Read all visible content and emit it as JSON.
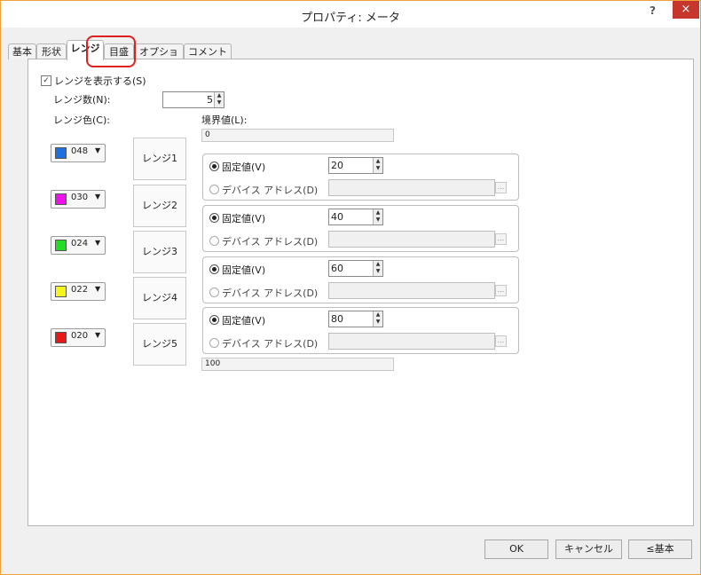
{
  "window": {
    "title": "プロパティ: メータ",
    "help_label": "?",
    "close_label": "×"
  },
  "tabs": [
    {
      "label": "基本"
    },
    {
      "label": "形状"
    },
    {
      "label": "レンジ"
    },
    {
      "label": "目盛"
    },
    {
      "label": "オプション"
    },
    {
      "label": "コメント"
    }
  ],
  "active_tab": "レンジ",
  "range_panel": {
    "show_range": {
      "label": "レンジを表示する(S)",
      "checked": true
    },
    "range_count": {
      "label": "レンジ数(N):",
      "value": "5"
    },
    "color_header": "レンジ色(C):",
    "boundary_header": "境界値(L):",
    "boundary_first": "0",
    "boundary_last": "100",
    "ranges": [
      {
        "color_code": "048",
        "color_hex": "#1e6fe0",
        "name": "レンジ1",
        "fixed_label": "固定値(V)",
        "fixed_value": "20",
        "device_label": "デバイス アドレス(D)",
        "dots_label": "..."
      },
      {
        "color_code": "030",
        "color_hex": "#ee11ee",
        "name": "レンジ2",
        "fixed_label": "固定値(V)",
        "fixed_value": "40",
        "device_label": "デバイス アドレス(D)",
        "dots_label": "..."
      },
      {
        "color_code": "024",
        "color_hex": "#22dd22",
        "name": "レンジ3",
        "fixed_label": "固定値(V)",
        "fixed_value": "60",
        "device_label": "デバイス アドレス(D)",
        "dots_label": "..."
      },
      {
        "color_code": "022",
        "color_hex": "#f5f51e",
        "name": "レンジ4",
        "fixed_label": "固定値(V)",
        "fixed_value": "80",
        "device_label": "デバイス アドレス(D)",
        "dots_label": "..."
      },
      {
        "color_code": "020",
        "color_hex": "#e81818",
        "name": "レンジ5"
      }
    ]
  },
  "buttons": {
    "ok": "OK",
    "cancel": "キャンセル",
    "basic": "≤基本"
  }
}
